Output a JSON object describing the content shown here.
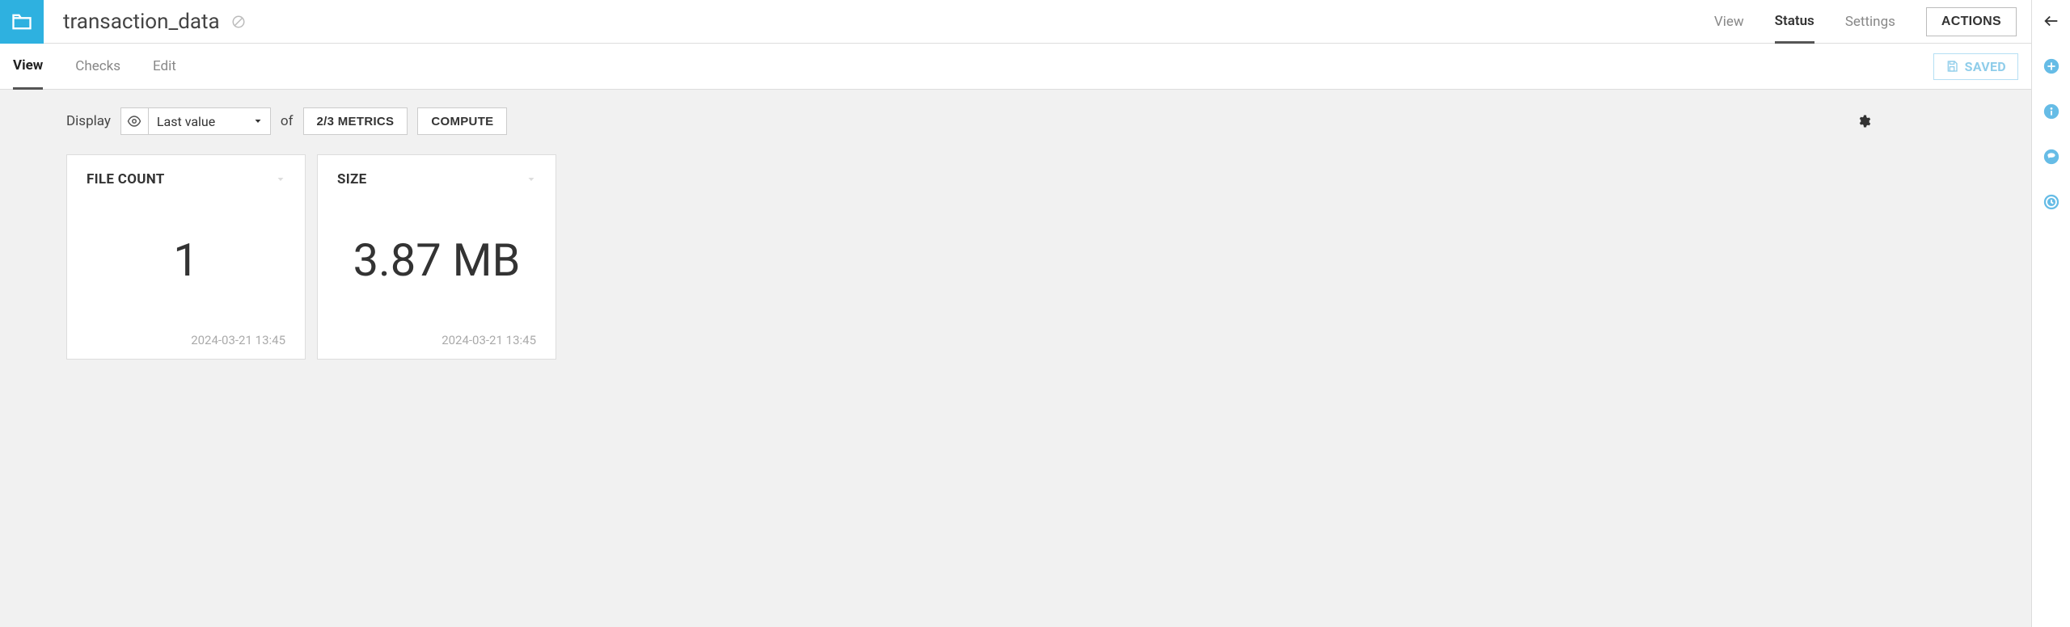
{
  "header": {
    "title": "transaction_data",
    "nav": [
      "View",
      "Status",
      "Settings"
    ],
    "nav_active": "Status",
    "actions_label": "ACTIONS"
  },
  "subheader": {
    "tabs": [
      "View",
      "Checks",
      "Edit"
    ],
    "tab_active": "View",
    "saved_label": "SAVED"
  },
  "toolbar": {
    "display_label": "Display",
    "select_value": "Last value",
    "of_label": "of",
    "metrics_label": "2/3 METRICS",
    "compute_label": "COMPUTE"
  },
  "cards": [
    {
      "title": "FILE COUNT",
      "value": "1",
      "timestamp": "2024-03-21 13:45"
    },
    {
      "title": "SIZE",
      "value": "3.87 MB",
      "timestamp": "2024-03-21 13:45"
    }
  ]
}
